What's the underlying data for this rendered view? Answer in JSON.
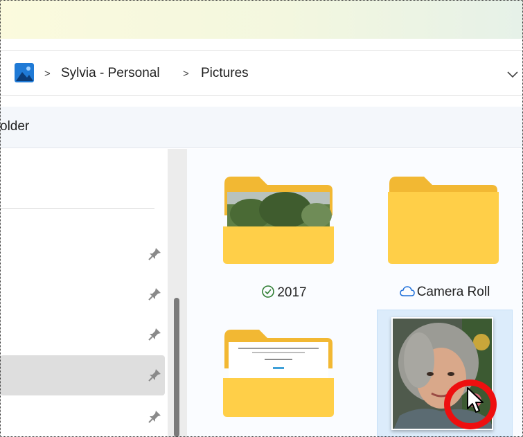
{
  "breadcrumb": {
    "items": [
      "Sylvia - Personal",
      "Pictures"
    ],
    "location_icon": "pictures-library-icon",
    "expand_icon": "chevron-down-icon"
  },
  "command_bar": {
    "partial_label": "older"
  },
  "navigation_pane": {
    "pin_icon": "pin-icon",
    "pinned_rows": 5,
    "selected_row": 4
  },
  "items": [
    {
      "name": "2017",
      "type": "folder",
      "status": "synced",
      "status_icon": "check-circle-icon"
    },
    {
      "name": "Camera Roll",
      "type": "folder",
      "status": "cloud",
      "status_icon": "cloud-icon"
    },
    {
      "name": "",
      "type": "folder",
      "preview": "document"
    },
    {
      "name": "",
      "type": "image",
      "selected": true
    }
  ],
  "colors": {
    "accent": "#0067c0",
    "folder_back": "#f2b833",
    "folder_front": "#ffcf48",
    "selection": "#dcecfb",
    "highlight_ring": "#ee0f0f",
    "sync_green": "#2e7d32",
    "cloud_blue": "#1e6fd9"
  }
}
